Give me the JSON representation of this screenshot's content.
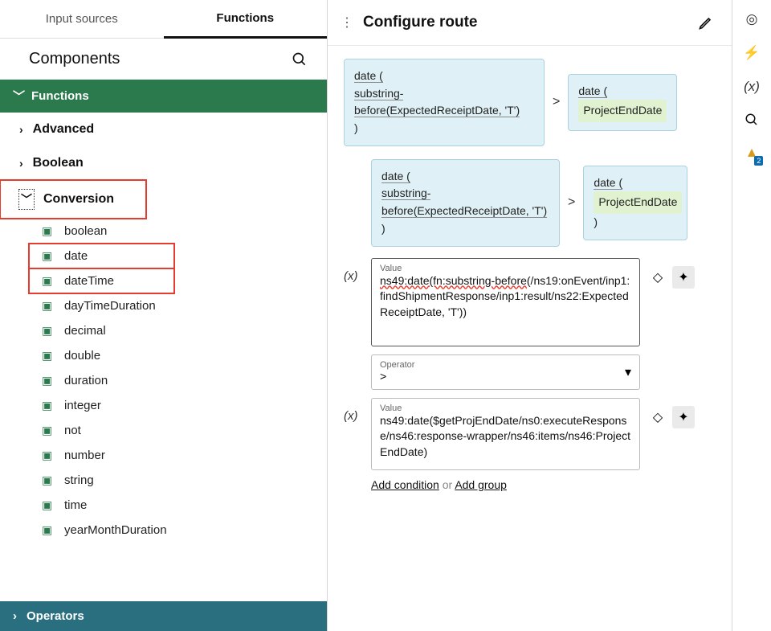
{
  "tabs": {
    "input_sources": "Input sources",
    "functions": "Functions"
  },
  "components_title": "Components",
  "sections": {
    "functions": "Functions",
    "advanced": "Advanced",
    "boolean": "Boolean",
    "conversion": "Conversion",
    "operators": "Operators"
  },
  "conversion_items": {
    "boolean": "boolean",
    "date": "date",
    "dateTime": "dateTime",
    "dayTimeDuration": "dayTimeDuration",
    "decimal": "decimal",
    "double": "double",
    "duration": "duration",
    "integer": "integer",
    "not": "not",
    "number": "number",
    "string": "string",
    "time": "time",
    "yearMonthDuration": "yearMonthDuration"
  },
  "configure_route_title": "Configure route",
  "expr1": {
    "left": {
      "fn": "date  (",
      "inner": "substring-before(ExpectedReceiptDate, 'T')",
      "close": ")"
    },
    "op": ">",
    "right": {
      "fn": "date  (",
      "inner": "ProjectEndDate"
    }
  },
  "expr2": {
    "left": {
      "fn": "date  (",
      "inner": "substring-before(ExpectedReceiptDate, 'T')",
      "close": ")"
    },
    "op": ">",
    "right": {
      "fn": "date  (",
      "inner": "ProjectEndDate",
      "close": ")"
    }
  },
  "var_symbol": "(x)",
  "value_label": "Value",
  "value1": {
    "part1": "ns49:date(fn:substring-before",
    "part2": "(/ns19:onEvent/inp1:findShipmentResponse/inp1:result/ns22:ExpectedReceiptDate, 'T'))"
  },
  "operator_label": "Operator",
  "operator_value": ">",
  "value2": "ns49:date($getProjEndDate/ns0:executeResponse/ns46:response-wrapper/ns46:items/ns46:ProjectEndDate)",
  "add_condition": "Add condition",
  "or_text": " or ",
  "add_group": "Add group",
  "alert_badge": "2"
}
